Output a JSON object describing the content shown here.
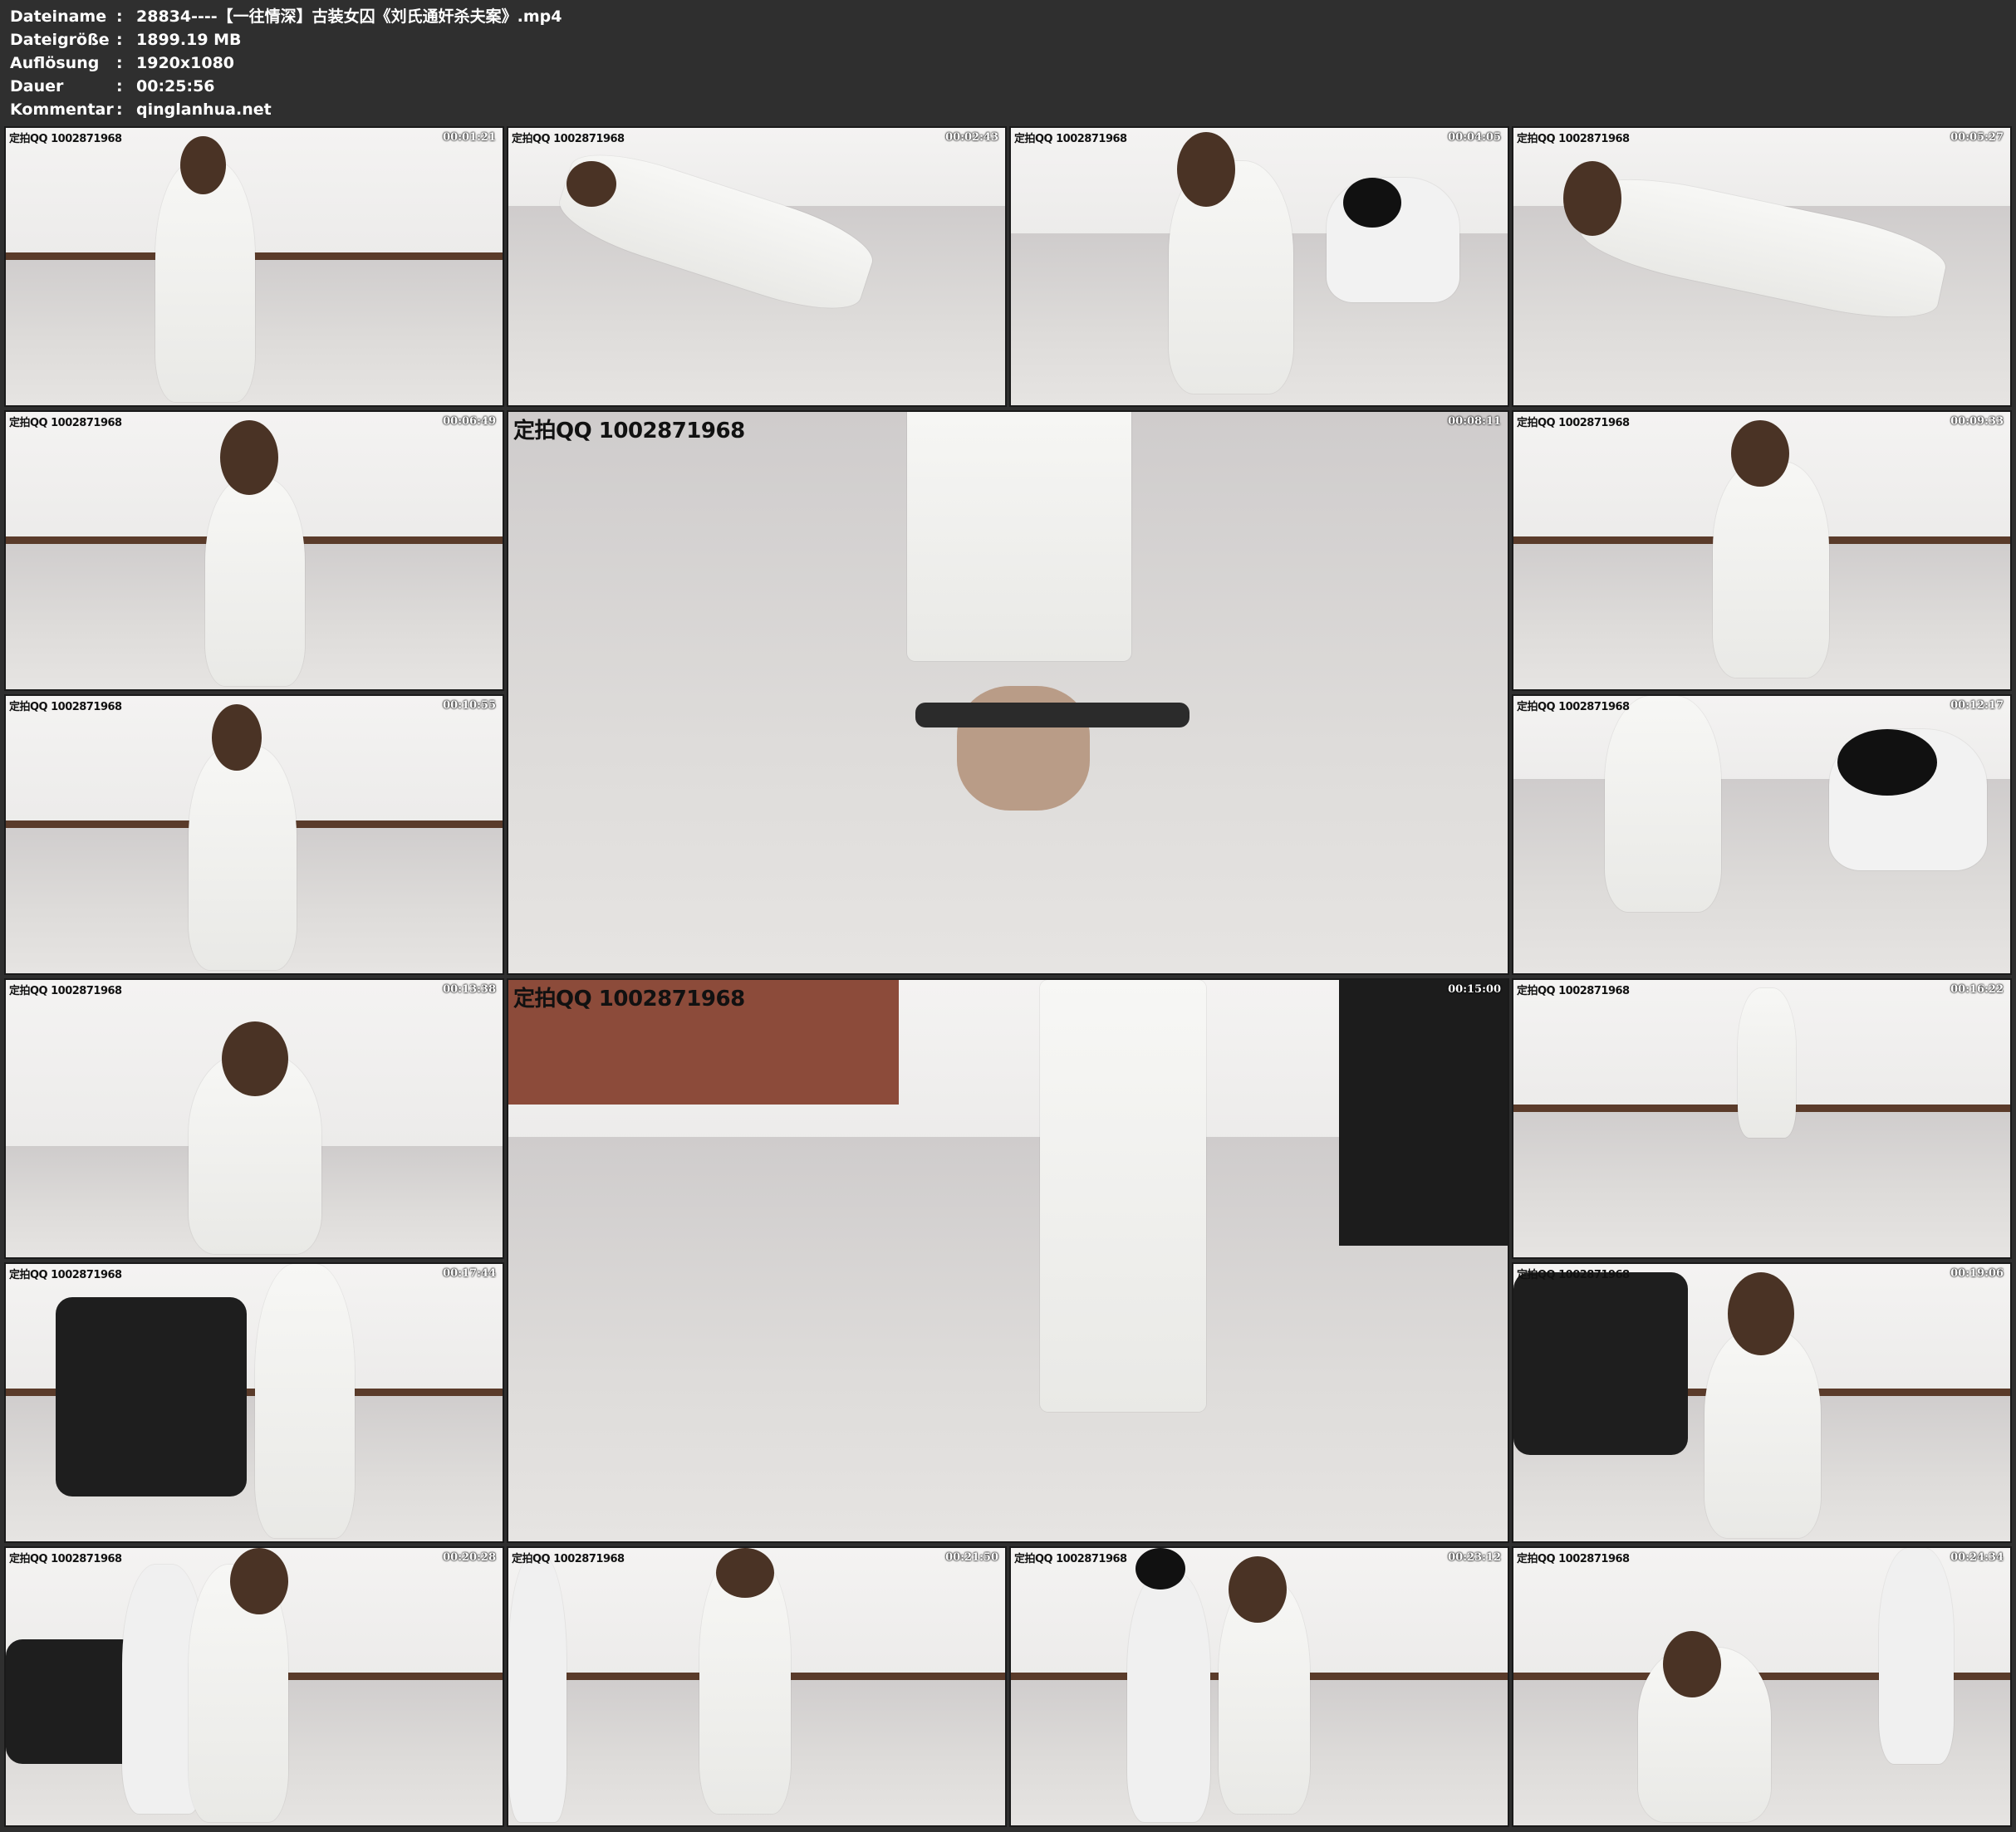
{
  "meta": {
    "rows": [
      {
        "label": "Dateiname",
        "sep": ":",
        "value": "28834----【一往情深】古装女囚《刘氏通奸杀夫案》.mp4"
      },
      {
        "label": "Dateigröße",
        "sep": ":",
        "value": "1899.19 MB"
      },
      {
        "label": "Auflösung",
        "sep": ":",
        "value": "1920x1080"
      },
      {
        "label": "Dauer",
        "sep": ":",
        "value": "00:25:56"
      },
      {
        "label": "Kommentar",
        "sep": ":",
        "value": "qinglanhua.net"
      }
    ]
  },
  "thumbnails": [
    {
      "watermark": "定拍QQ 1002871968",
      "time": "00:01:21"
    },
    {
      "watermark": "定拍QQ 1002871968",
      "time": "00:02:43"
    },
    {
      "watermark": "定拍QQ 1002871968",
      "time": "00:04:05"
    },
    {
      "watermark": "定拍QQ 1002871968",
      "time": "00:05:27"
    },
    {
      "watermark": "定拍QQ 1002871968",
      "time": "00:06:49"
    },
    {
      "watermark": "定拍QQ 1002871968",
      "time": "00:08:11"
    },
    {
      "watermark": "定拍QQ 1002871968",
      "time": "00:09:33"
    },
    {
      "watermark": "定拍QQ 1002871968",
      "time": "00:10:55"
    },
    {
      "watermark": "定拍QQ 1002871968",
      "time": "00:12:17"
    },
    {
      "watermark": "定拍QQ 1002871968",
      "time": "00:13:38"
    },
    {
      "watermark": "定拍QQ 1002871968",
      "time": "00:15:00"
    },
    {
      "watermark": "定拍QQ 1002871968",
      "time": "00:16:22"
    },
    {
      "watermark": "定拍QQ 1002871968",
      "time": "00:17:44"
    },
    {
      "watermark": "定拍QQ 1002871968",
      "time": "00:19:06"
    },
    {
      "watermark": "定拍QQ 1002871968",
      "time": "00:20:28"
    },
    {
      "watermark": "定拍QQ 1002871968",
      "time": "00:21:50"
    },
    {
      "watermark": "定拍QQ 1002871968",
      "time": "00:23:12"
    },
    {
      "watermark": "定拍QQ 1002871968",
      "time": "00:24:34"
    }
  ],
  "colors": {
    "background": "#2f2f2f",
    "header_text": "#ffffff",
    "timecode_text": "#ffffff",
    "watermark_text": "#111111"
  }
}
